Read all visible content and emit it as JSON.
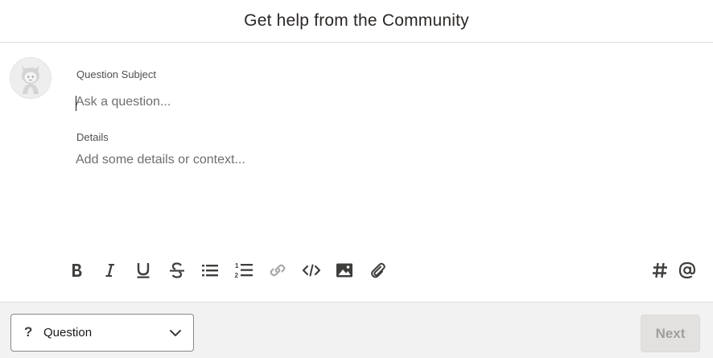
{
  "header": {
    "title": "Get help from the Community"
  },
  "avatar": {
    "icon": "astro-avatar-icon"
  },
  "form": {
    "subject_label": "Question Subject",
    "subject_placeholder": "Ask a question...",
    "subject_value": "",
    "details_label": "Details",
    "details_placeholder": "Add some details or context...",
    "details_value": ""
  },
  "toolbar": {
    "tools": [
      {
        "name": "bold",
        "icon": "bold-icon",
        "enabled": true
      },
      {
        "name": "italic",
        "icon": "italic-icon",
        "enabled": true
      },
      {
        "name": "underline",
        "icon": "underline-icon",
        "enabled": true
      },
      {
        "name": "strikethrough",
        "icon": "strikethrough-icon",
        "enabled": true
      },
      {
        "name": "bulleted list",
        "icon": "bulleted-list-icon",
        "enabled": true
      },
      {
        "name": "numbered list",
        "icon": "numbered-list-icon",
        "enabled": true
      },
      {
        "name": "link",
        "icon": "link-icon",
        "enabled": false
      },
      {
        "name": "code",
        "icon": "code-icon",
        "enabled": true
      },
      {
        "name": "image",
        "icon": "image-icon",
        "enabled": true
      },
      {
        "name": "attach",
        "icon": "attach-icon",
        "enabled": true
      },
      {
        "name": "topic",
        "icon": "hashtag-icon",
        "enabled": true
      },
      {
        "name": "mention",
        "icon": "mention-icon",
        "enabled": true
      }
    ]
  },
  "footer": {
    "type_icon": "?",
    "type_label": "Question",
    "next_label": "Next",
    "next_enabled": false
  },
  "colors": {
    "toolbar_icon": "#3e3e3c",
    "disabled_icon": "#a8a8a8",
    "footer_bg": "#f3f2f2",
    "next_disabled_bg": "#e2e1e0",
    "next_disabled_text": "#a19f9d"
  }
}
